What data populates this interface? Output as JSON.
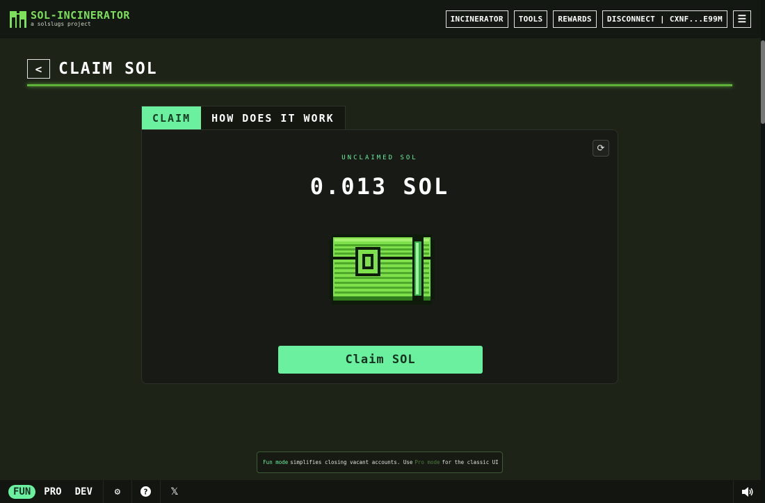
{
  "header": {
    "brand_title": "SOL-INCINERATOR",
    "brand_subtitle": "a solslugs project",
    "nav": {
      "incinerator": "INCINERATOR",
      "tools": "TOOLS",
      "rewards": "REWARDS",
      "disconnect": "DISCONNECT | CXNF...E99M"
    }
  },
  "page": {
    "back_label": "<",
    "title": "CLAIM SOL"
  },
  "tabs": {
    "claim": "CLAIM",
    "how": "HOW DOES IT WORK"
  },
  "card": {
    "label": "UNCLAIMED SOL",
    "amount": "0.013 SOL",
    "claim_button": "Claim SOL"
  },
  "notice": {
    "fun_mode": "Fun mode",
    "text1": "simplifies closing vacant accounts. Use",
    "pro_mode": "Pro mode",
    "text2": "for the classic UI"
  },
  "footer": {
    "modes": {
      "fun": "FUN",
      "pro": "PRO",
      "dev": "DEV"
    },
    "active_mode": "FUN"
  },
  "icons": [
    "menu-icon",
    "refresh-icon",
    "treasure-chest-icon",
    "gear-icon",
    "help-icon",
    "x-logo-icon",
    "speaker-icon"
  ],
  "colors": {
    "accent": "#6bf0a0",
    "brand": "#7ce05a",
    "background": "#1e2318"
  }
}
